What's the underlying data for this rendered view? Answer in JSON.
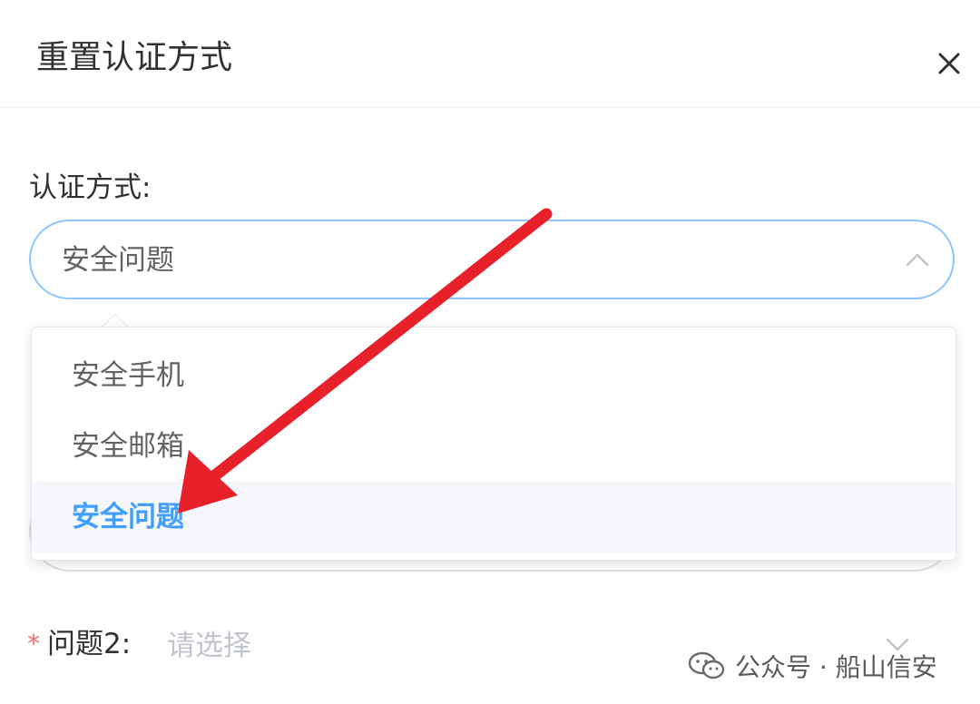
{
  "dialog": {
    "title": "重置认证方式"
  },
  "form": {
    "auth_label": "认证方式:",
    "auth_select_value": "安全问题"
  },
  "dropdown": {
    "options": [
      {
        "label": "安全手机",
        "selected": false
      },
      {
        "label": "安全邮箱",
        "selected": false
      },
      {
        "label": "安全问题",
        "selected": true
      }
    ]
  },
  "question2": {
    "required_mark": "*",
    "label": "问题2:",
    "placeholder": "请选择"
  },
  "watermark": {
    "text": "公众号 · 船山信安"
  },
  "colors": {
    "accent": "#409eff",
    "select_border": "#8ec5fc",
    "annotation_arrow": "#e8202a",
    "required": "#f56c6c"
  },
  "icons": {
    "close": "close-icon",
    "select_arrow": "chevron-up-icon",
    "question_arrow": "chevron-down-icon",
    "annotation": "arrow-annotation-icon",
    "watermark": "wechat-icon"
  }
}
